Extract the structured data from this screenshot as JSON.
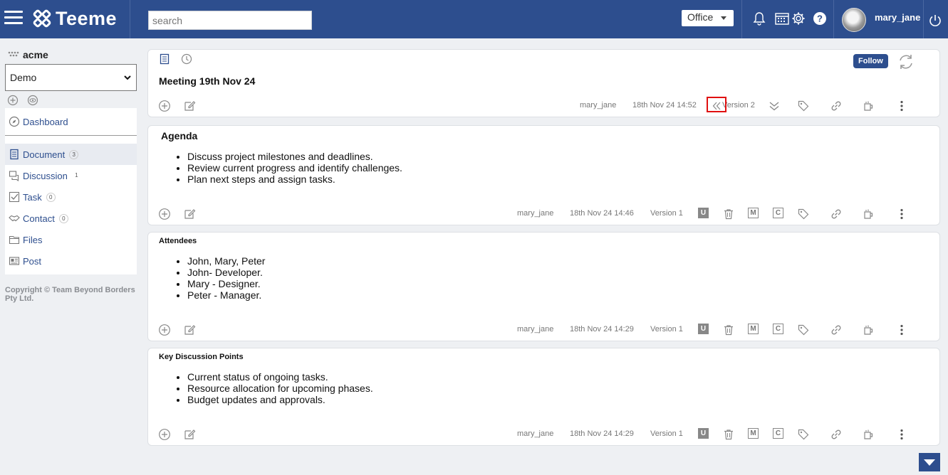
{
  "header": {
    "app_name": "Teeme",
    "search_placeholder": "search",
    "workspace": "Office",
    "username": "mary_jane"
  },
  "sidebar": {
    "org": "acme",
    "space": "Demo",
    "dashboard": "Dashboard",
    "items": [
      {
        "label": "Document",
        "count": "3"
      },
      {
        "label": "Discussion",
        "count": "1"
      },
      {
        "label": "Task",
        "count": "0"
      },
      {
        "label": "Contact",
        "count": "0"
      },
      {
        "label": "Files",
        "count": ""
      },
      {
        "label": "Post",
        "count": ""
      }
    ],
    "copyright": "Copyright © Team Beyond Borders Pty Ltd."
  },
  "document": {
    "title": "Meeting 19th Nov 24",
    "follow_label": "Follow",
    "author": "mary_jane",
    "timestamp": "18th Nov 24 14:52",
    "version": "Version 2"
  },
  "sections": [
    {
      "title": "Agenda",
      "items": [
        "Discuss project milestones and deadlines.",
        "Review current progress and identify challenges.",
        "Plan next steps and assign tasks."
      ],
      "author": "mary_jane",
      "timestamp": "18th Nov 24 14:46",
      "version": "Version 1"
    },
    {
      "title": "Attendees",
      "items": [
        "John, Mary, Peter",
        "John- Developer.",
        "Mary - Designer.",
        "Peter - Manager."
      ],
      "author": "mary_jane",
      "timestamp": "18th Nov 24 14:29",
      "version": "Version 1"
    },
    {
      "title": "Key Discussion Points",
      "items": [
        "Current status of ongoing tasks.",
        "Resource allocation for upcoming phases.",
        "Budget updates and approvals."
      ],
      "author": "mary_jane",
      "timestamp": "18th Nov 24 14:29",
      "version": "Version 1"
    }
  ],
  "letters": {
    "u": "U",
    "m": "M",
    "c": "C"
  },
  "colors": {
    "brand": "#2d4e8e",
    "highlight": "#e01010"
  }
}
